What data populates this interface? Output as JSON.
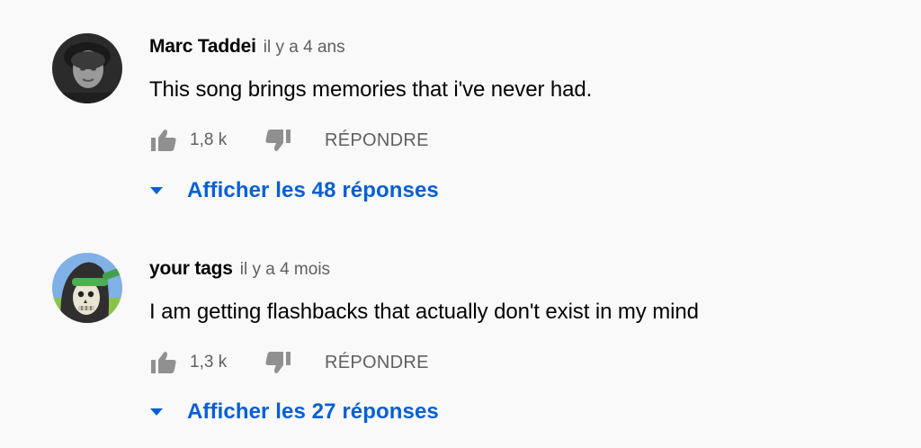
{
  "comments": [
    {
      "author": "Marc Taddei",
      "time": "il y a 4 ans",
      "text": "This song brings memories that i've never had.",
      "likes": "1,8 k",
      "reply_label": "RÉPONDRE",
      "replies_label": "Afficher les 48 réponses",
      "avatar_icon": "user-photo-avatar"
    },
    {
      "author": "your tags",
      "time": "il y a 4 mois",
      "text": "I am getting flashbacks that actually don't exist in my mind",
      "likes": "1,3 k",
      "reply_label": "RÉPONDRE",
      "replies_label": "Afficher les 27 réponses",
      "avatar_icon": "skeleton-avatar"
    }
  ],
  "colors": {
    "background": "#f9f9f9",
    "text_primary": "#030303",
    "text_secondary": "#606060",
    "link_blue": "#065fd4"
  }
}
